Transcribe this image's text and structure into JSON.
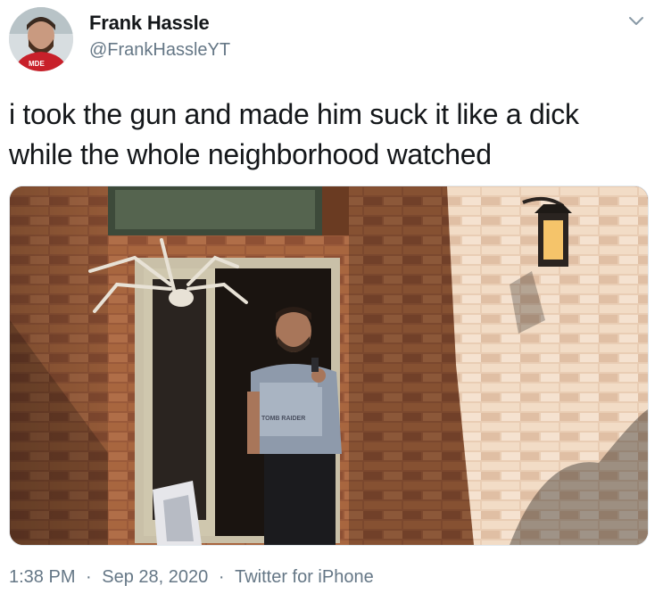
{
  "author": {
    "display_name": "Frank Hassle",
    "handle": "@FrankHassleYT",
    "avatar_shirt_text": "MDE"
  },
  "tweet": {
    "text": "i took the gun and made him suck it like a dick\nwhile the whole neighborhood watched"
  },
  "media": {
    "shirt_text": "TOMB RAIDER"
  },
  "meta": {
    "time": "1:38 PM",
    "date": "Sep 28, 2020",
    "separator": "·",
    "source": "Twitter for iPhone"
  },
  "icons": {
    "menu": "chevron-down-icon"
  }
}
